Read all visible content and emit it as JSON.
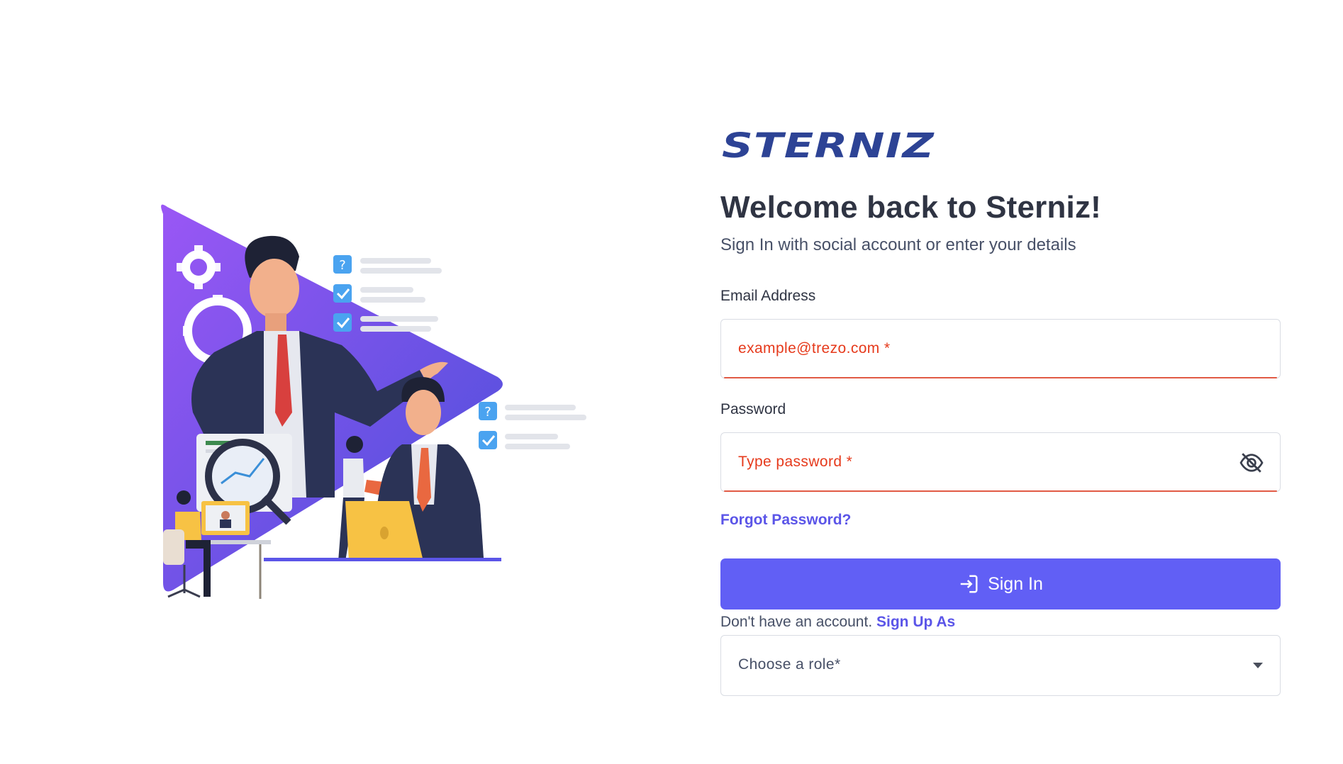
{
  "brand": {
    "logo_text": "STERNIZ",
    "logo_color": "#2d4395"
  },
  "header": {
    "title": "Welcome back to Sterniz!",
    "subtitle": "Sign In with social account or enter your details"
  },
  "form": {
    "email": {
      "label": "Email Address",
      "placeholder": "example@trezo.com *",
      "value": ""
    },
    "password": {
      "label": "Password",
      "placeholder": "Type password *",
      "value": "",
      "visibility_icon": "eye-off-icon"
    },
    "forgot_password": "Forgot Password?",
    "submit": {
      "label": "Sign In",
      "icon": "login-icon"
    },
    "signup": {
      "prompt": "Don't have an account.",
      "link": "Sign Up As"
    },
    "role_select": {
      "placeholder": "Choose a role*",
      "icon": "caret-down-icon"
    }
  },
  "colors": {
    "accent": "#615ff5",
    "link": "#5b55e8",
    "error": "#e15a45",
    "text": "#2f3443"
  }
}
